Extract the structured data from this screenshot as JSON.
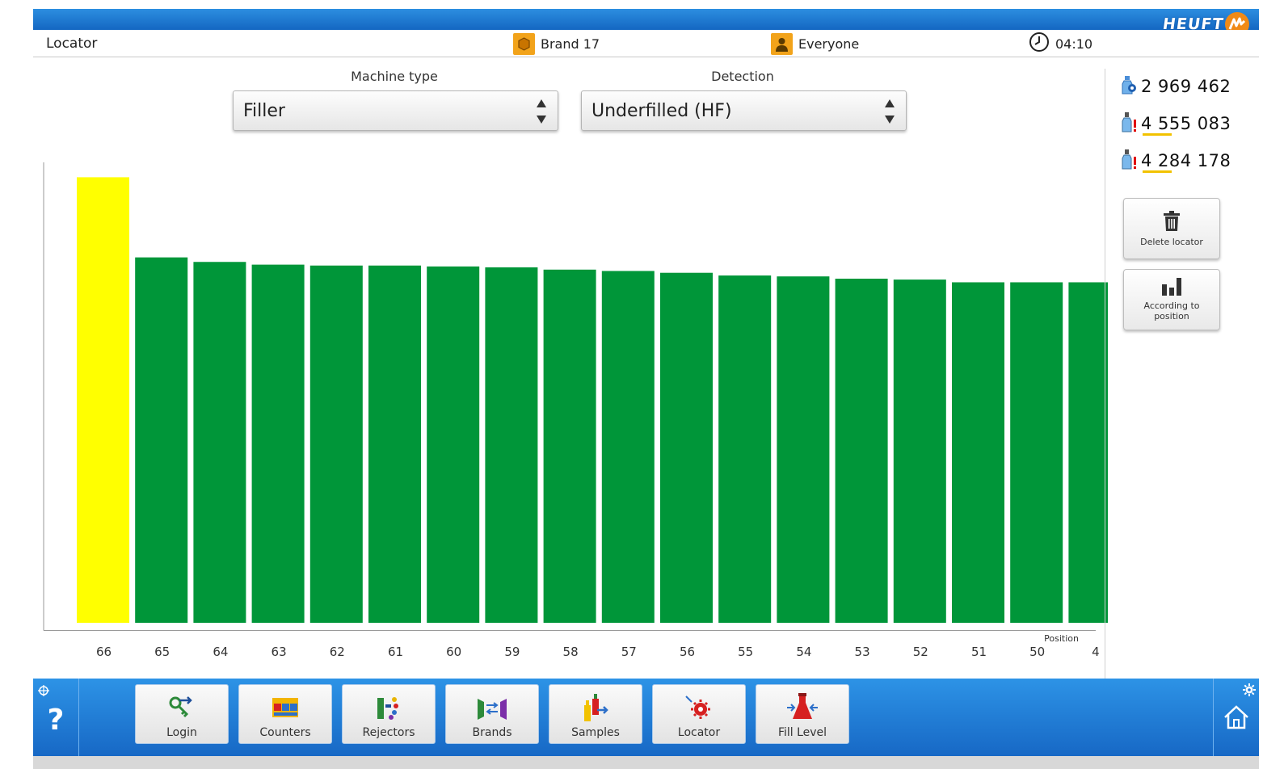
{
  "header": {
    "brand_logo_text": "HEUFT",
    "page_title": "Locator",
    "brand": "Brand 17",
    "user": "Everyone",
    "time": "04:10"
  },
  "selectors": {
    "machine_type_label": "Machine type",
    "machine_type_value": "Filler",
    "detection_label": "Detection",
    "detection_value": "Underfilled (HF)"
  },
  "counters": [
    {
      "icon": "bottle-gear-icon",
      "value": "2 969 462"
    },
    {
      "icon": "bottle-reject-icon",
      "value": "4 555 083"
    },
    {
      "icon": "bottle-reject-icon",
      "value": "4 284 178"
    }
  ],
  "side_buttons": {
    "delete_label": "Delete locator",
    "position_label": "According to position"
  },
  "nav": [
    {
      "label": "Login",
      "icon": "key-arrow-icon"
    },
    {
      "label": "Counters",
      "icon": "counters-icon"
    },
    {
      "label": "Rejectors",
      "icon": "rejectors-icon"
    },
    {
      "label": "Brands",
      "icon": "brands-icon"
    },
    {
      "label": "Samples",
      "icon": "samples-icon"
    },
    {
      "label": "Locator",
      "icon": "locator-gear-icon"
    },
    {
      "label": "Fill Level",
      "icon": "fill-level-icon"
    }
  ],
  "colors": {
    "highlight_bar": "#ffff00",
    "bar": "#009639",
    "accent_blue": "#1e7ad6",
    "logo_orange": "#f08a16"
  },
  "chart_data": {
    "type": "bar",
    "xlabel": "Position",
    "ylabel": "",
    "categories": [
      "66",
      "65",
      "64",
      "63",
      "62",
      "61",
      "60",
      "59",
      "58",
      "57",
      "56",
      "55",
      "54",
      "53",
      "52",
      "51",
      "50",
      "4"
    ],
    "values": [
      100,
      82.3,
      81.3,
      80.7,
      80.5,
      80.5,
      80.3,
      80.1,
      79.6,
      79.3,
      78.9,
      78.3,
      78.1,
      77.6,
      77.4,
      76.8,
      76.8,
      76.8
    ],
    "highlight_index": 0,
    "ylim": [
      0,
      104
    ],
    "grid": false
  }
}
